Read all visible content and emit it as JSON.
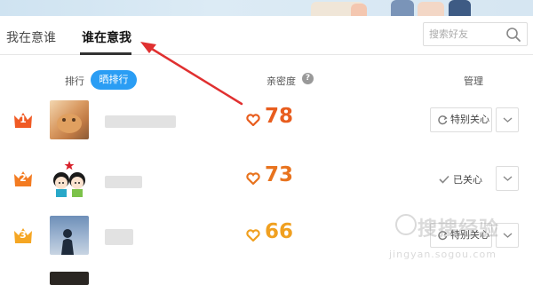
{
  "tabs": [
    {
      "label": "我在意谁"
    },
    {
      "label": "谁在意我"
    }
  ],
  "search": {
    "placeholder": "搜索好友"
  },
  "list_header": {
    "rank_label": "排行",
    "show_rank_button": "晒排行",
    "intimacy_label": "亲密度",
    "help_glyph": "?",
    "manage_label": "管理"
  },
  "rows": [
    {
      "rank": "1",
      "score": "78",
      "score_color": "#e85d1e",
      "action": "特别关心",
      "action_type": "button"
    },
    {
      "rank": "2",
      "score": "73",
      "score_color": "#e8731e",
      "action": "已关心",
      "action_type": "status"
    },
    {
      "rank": "3",
      "score": "66",
      "score_color": "#f0a020",
      "action": "特别关心",
      "action_type": "button"
    }
  ],
  "colors": {
    "accent_blue": "#2a9df4",
    "rank_1": "#f05a24",
    "rank_2": "#f37b21",
    "rank_3": "#f5a623",
    "annotation_arrow": "#e03030"
  },
  "watermark": {
    "text": "搜搜经验",
    "sub": "jingyan.sogou.com"
  }
}
